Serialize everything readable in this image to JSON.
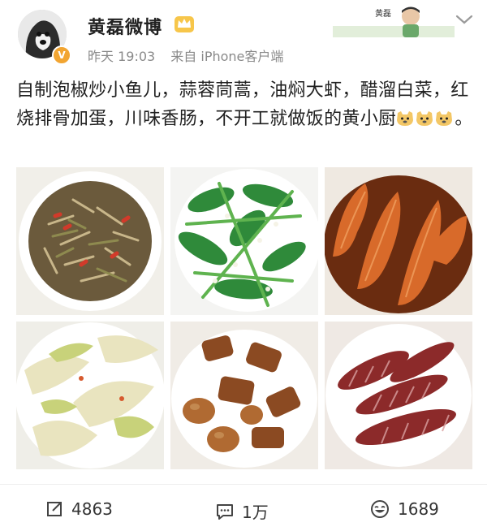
{
  "post": {
    "username": "黄磊微博",
    "time": "昨天 19:03",
    "source": "来自 iPhone客户端",
    "banner_name": "黄磊",
    "text": "自制泡椒炒小鱼儿，蒜蓉茼蒿，油焖大虾，醋溜白菜，红烧排骨加蛋，川味香肠，不开工就做饭的黄小厨",
    "text_end": "。"
  },
  "icons": {
    "crown": "crown-icon",
    "verified": "verified-v-icon",
    "more": "chevron-down-icon",
    "emoji": "doge-emoji-icon",
    "repost": "repost-icon",
    "comment": "comment-icon",
    "like": "like-icon"
  },
  "photos": [
    "泡椒炒小鱼儿",
    "蒜蓉茼蒿",
    "油焖大虾",
    "醋溜白菜",
    "红烧排骨加蛋",
    "川味香肠"
  ],
  "actions": {
    "repost_count": "4863",
    "comment_count": "1万",
    "like_count": "1689"
  },
  "colors": {
    "badge": "#f2a531",
    "meta_text": "#8a8a8a",
    "text": "#1f1f1f"
  }
}
